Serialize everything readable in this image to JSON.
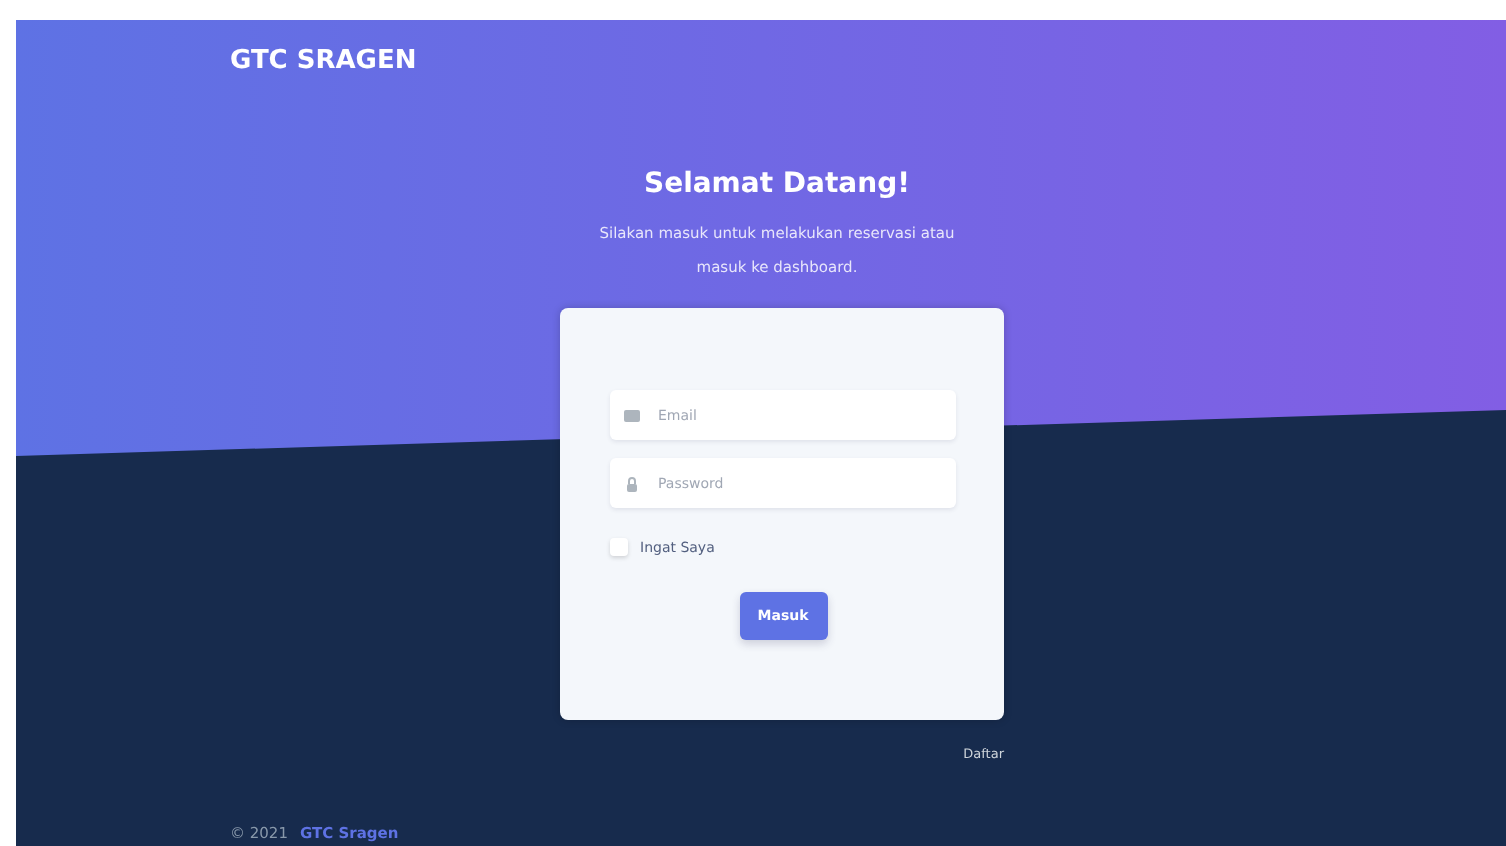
{
  "brand": "GTC SRAGEN",
  "heading": "Selamat Datang!",
  "subtitle": "Silakan masuk untuk melakukan reservasi atau masuk ke dashboard.",
  "form": {
    "email": {
      "placeholder": "Email"
    },
    "password": {
      "placeholder": "Password"
    },
    "remember": {
      "label": "Ingat Saya",
      "checked": false
    },
    "submit": "Masuk"
  },
  "register_link": "Daftar",
  "footer": {
    "copyright": "© 2021",
    "link": "GTC Sragen"
  }
}
